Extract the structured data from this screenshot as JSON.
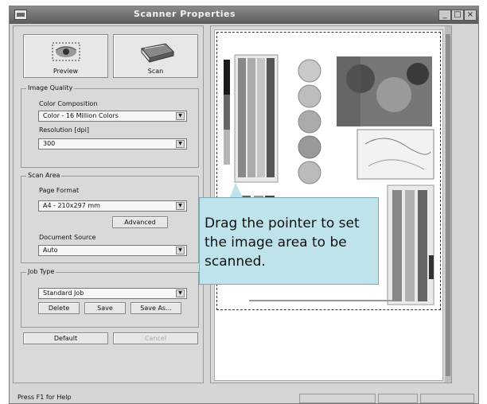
{
  "window": {
    "title": "Scanner Properties",
    "min_symbol": "_",
    "max_symbol": "□",
    "close_symbol": "×"
  },
  "actions": {
    "preview_label": "Preview",
    "scan_label": "Scan"
  },
  "image_quality": {
    "legend": "Image Quality",
    "color_label": "Color Composition",
    "color_value": "Color - 16 Million Colors",
    "resolution_label": "Resolution [dpi]",
    "resolution_value": "300"
  },
  "scan_area": {
    "legend": "Scan Area",
    "page_format_label": "Page Format",
    "page_format_value": "A4 - 210x297 mm",
    "advanced_label": "Advanced",
    "doc_source_label": "Document Source",
    "doc_source_value": "Auto"
  },
  "job_type": {
    "legend": "Job Type",
    "value": "Standard Job",
    "delete_label": "Delete",
    "save_label": "Save",
    "save_as_label": "Save As..."
  },
  "bottom": {
    "default_label": "Default",
    "cancel_label": "Cancel"
  },
  "tooltip": {
    "text": "Drag the pointer to set the image area to be scanned."
  },
  "status": {
    "help_text": "Press F1 for Help"
  },
  "icons": [
    "app-icon",
    "eye-preview-icon",
    "scanner-icon",
    "dropdown-arrow-icon"
  ]
}
